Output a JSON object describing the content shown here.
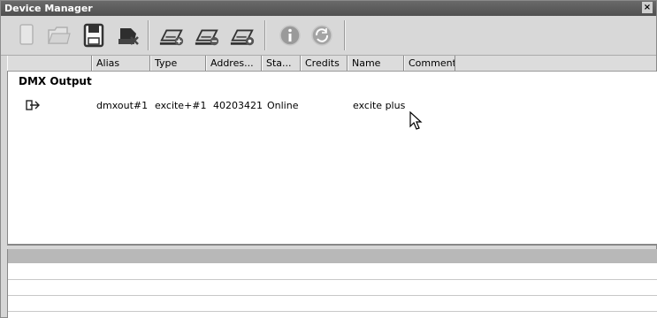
{
  "window": {
    "title": "Device Manager",
    "close_glyph": "×"
  },
  "toolbar": {
    "buttons": [
      {
        "name": "new-icon"
      },
      {
        "name": "open-folder-icon"
      },
      {
        "name": "save-icon"
      },
      {
        "name": "remove-device-icon"
      },
      {
        "name": "add-interface-icon"
      },
      {
        "name": "remove-interface-icon"
      },
      {
        "name": "interface-settings-icon"
      },
      {
        "name": "info-icon"
      },
      {
        "name": "refresh-icon"
      }
    ]
  },
  "columns": [
    "",
    "Alias",
    "Type",
    "Addres...",
    "Sta...",
    "Credits",
    "Name",
    "Comment"
  ],
  "groups": [
    {
      "label": "DMX Output",
      "rows": [
        {
          "icon": "output-arrow-icon",
          "alias": "dmxout#1",
          "type": "excite+#1",
          "address": "40203421",
          "status": "Online",
          "credits": "",
          "name": "excite plus",
          "comment": ""
        }
      ]
    }
  ]
}
